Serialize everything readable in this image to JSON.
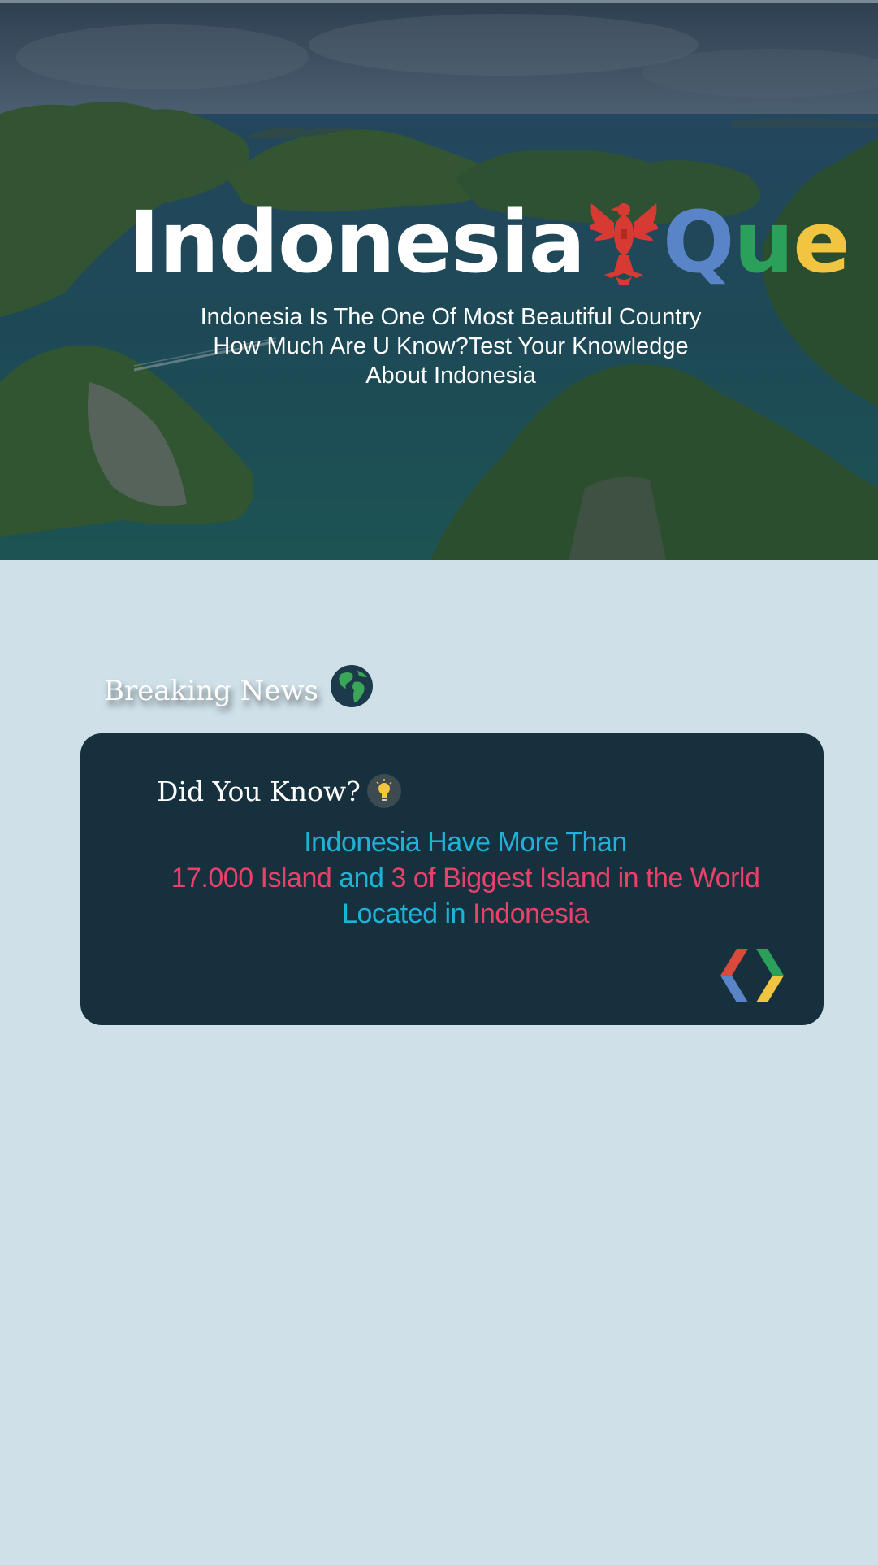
{
  "colors": {
    "page_bg": "#cfe0e8",
    "card_bg": "#16303e",
    "accent_blue": "#1fb2d8",
    "accent_pink": "#e8416a",
    "q_color": "#5a84c8",
    "u_color": "#2aa05a",
    "e_color": "#f2c540",
    "garuda_red": "#d63a32"
  },
  "hero": {
    "brand_word": "Indonesia",
    "brand_q": "Q",
    "brand_u": "u",
    "brand_e": "e",
    "emblem_icon": "garuda-emblem-icon",
    "tagline_line1": "Indonesia Is The One Of Most Beautiful  Country",
    "tagline_line2": "How Much Are U Know?Test Your Knowledge",
    "tagline_line3": "About Indonesia"
  },
  "news": {
    "heading": "Breaking News",
    "heading_icon": "globe-icon"
  },
  "card": {
    "title": "Did You Know?",
    "title_icon": "lightbulb-icon",
    "fact": {
      "line1": "Indonesia Have More Than",
      "line2_part1": "17.000 Island",
      "line2_part2": " and ",
      "line2_part3": "3 of Biggest Island in the World",
      "line3_part1": "Located in ",
      "line3_part2": "Indonesia"
    },
    "footer_icon": "code-chevrons-icon"
  }
}
